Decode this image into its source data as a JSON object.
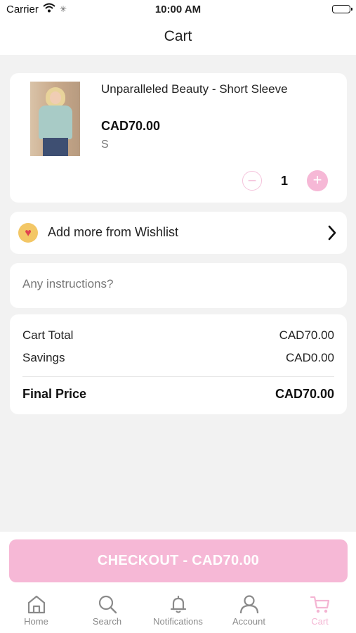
{
  "status_bar": {
    "carrier": "Carrier",
    "time": "10:00 AM"
  },
  "nav": {
    "title": "Cart"
  },
  "cart_item": {
    "name": "Unparalleled Beauty - Short Sleeve",
    "price": "CAD70.00",
    "size": "S",
    "quantity": "1",
    "minus_symbol": "−",
    "plus_symbol": "+"
  },
  "wishlist": {
    "label": "Add more from Wishlist",
    "icon": "heart-icon"
  },
  "instructions": {
    "placeholder": "Any instructions?",
    "value": ""
  },
  "summary": {
    "cart_total_label": "Cart Total",
    "cart_total_value": "CAD70.00",
    "savings_label": "Savings",
    "savings_value": "CAD0.00",
    "final_label": "Final Price",
    "final_value": "CAD70.00"
  },
  "checkout": {
    "label": "CHECKOUT - CAD70.00"
  },
  "tabs": [
    {
      "label": "Home",
      "icon": "home-icon"
    },
    {
      "label": "Search",
      "icon": "search-icon"
    },
    {
      "label": "Notifications",
      "icon": "bell-icon"
    },
    {
      "label": "Account",
      "icon": "user-icon"
    },
    {
      "label": "Cart",
      "icon": "cart-icon",
      "active": true
    }
  ],
  "colors": {
    "accent_pink": "#f6b8d6",
    "background": "#f2f2f2",
    "wishlist_badge": "#f3c766"
  }
}
